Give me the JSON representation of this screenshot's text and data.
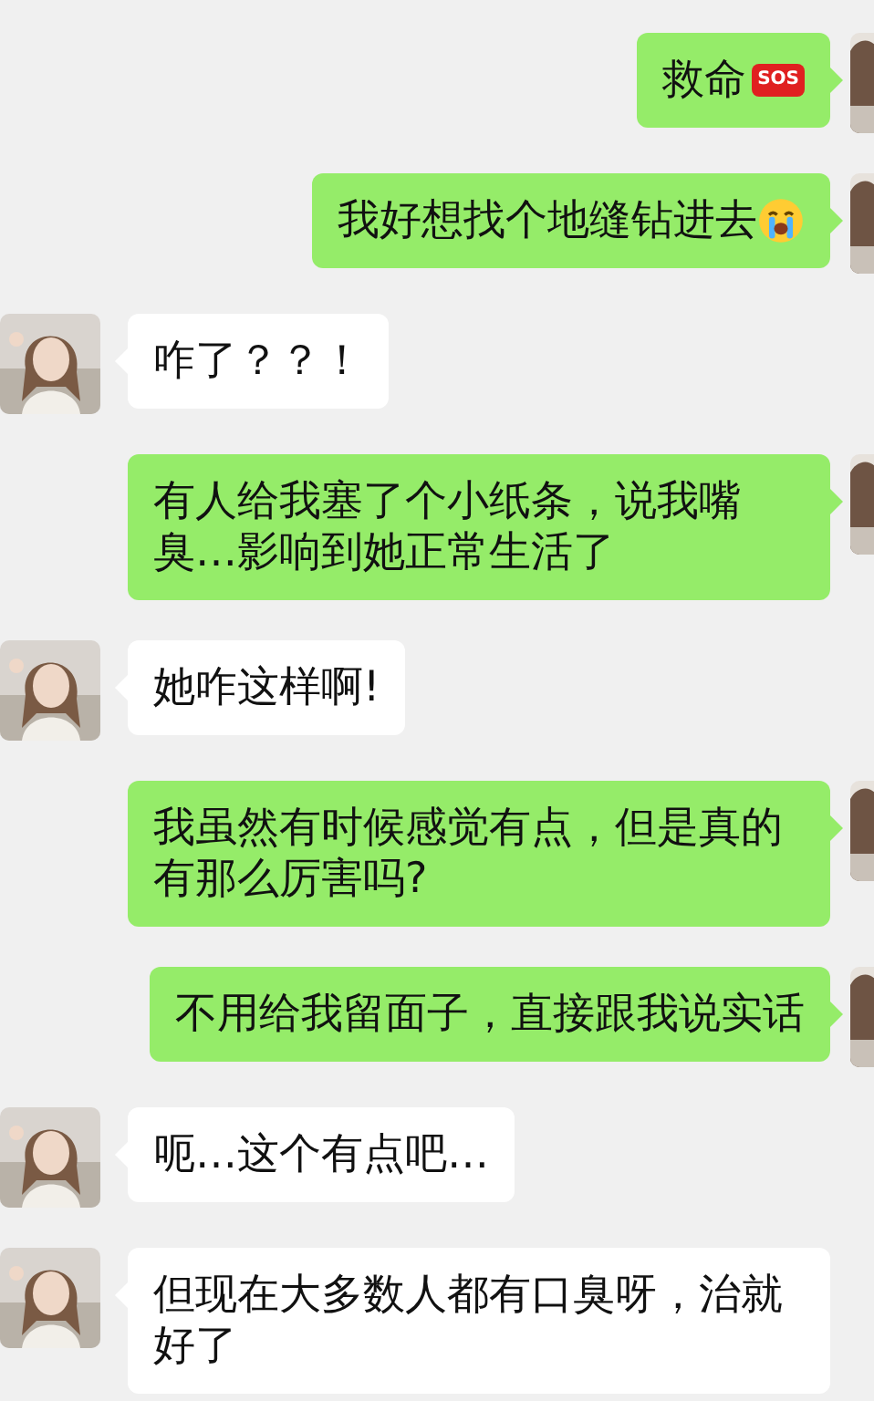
{
  "messages": [
    {
      "kind": "outgoing",
      "text": "救命",
      "badge": "SOS"
    },
    {
      "kind": "outgoing",
      "text": "我好想找个地缝钻进去",
      "emoji": true
    },
    {
      "kind": "incoming",
      "text": "咋了？？！"
    },
    {
      "kind": "outgoing",
      "text": "有人给我塞了个小纸条，说我嘴臭…影响到她正常生活了"
    },
    {
      "kind": "incoming",
      "text": "她咋这样啊!"
    },
    {
      "kind": "outgoing",
      "text": "我虽然有时候感觉有点，但是真的有那么厉害吗?"
    },
    {
      "kind": "outgoing",
      "text": "不用给我留面子，直接跟我说实话"
    },
    {
      "kind": "incoming",
      "text": "呃…这个有点吧…"
    },
    {
      "kind": "incoming",
      "text": "但现在大多数人都有口臭呀，治就好了"
    }
  ]
}
